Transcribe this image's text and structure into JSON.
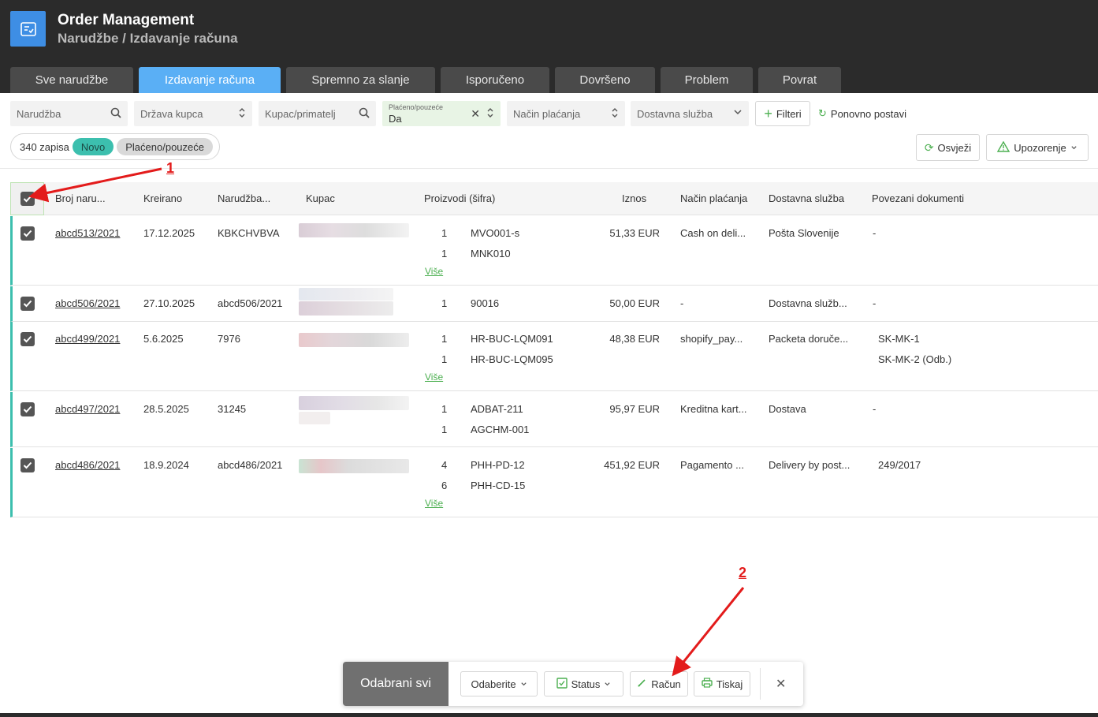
{
  "app": {
    "title": "Order Management",
    "breadcrumb": "Narudžbe / Izdavanje računa"
  },
  "tabs": [
    {
      "label": "Sve narudžbe",
      "active": false
    },
    {
      "label": "Izdavanje računa",
      "active": true
    },
    {
      "label": "Spremno za slanje",
      "active": false
    },
    {
      "label": "Isporučeno",
      "active": false
    },
    {
      "label": "Dovršeno",
      "active": false
    },
    {
      "label": "Problem",
      "active": false
    },
    {
      "label": "Povrat",
      "active": false
    }
  ],
  "filters": {
    "order_placeholder": "Narudžba",
    "country_placeholder": "Država kupca",
    "customer_placeholder": "Kupac/primatelj",
    "paid_label": "Plaćeno/pouzeće",
    "paid_value": "Da",
    "payment_placeholder": "Način plaćanja",
    "delivery_placeholder": "Dostavna služba",
    "filters_button": "Filteri",
    "reset_button": "Ponovno postavi"
  },
  "summary": {
    "count_text": "340 zapisa",
    "tag_new": "Novo",
    "tag_paid": "Plaćeno/pouzeće"
  },
  "actions": {
    "refresh": "Osvježi",
    "warning": "Upozorenje"
  },
  "table": {
    "columns": [
      "Broj naru...",
      "Kreirano",
      "Narudžba...",
      "Kupac",
      "Proizvodi (šifra)",
      "Iznos",
      "Način plaćanja",
      "Dostavna služba",
      "Povezani dokumenti"
    ],
    "more_label": "Više",
    "rows": [
      {
        "number": "abcd513/2021",
        "created": "17.12.2025",
        "order": "KBKCHVBVA",
        "products": [
          {
            "qty": "1",
            "code": "MVO001-s"
          },
          {
            "qty": "1",
            "code": "MNK010"
          }
        ],
        "more": true,
        "amount": "51,33 EUR",
        "payment": "Cash on deli...",
        "delivery": "Pošta Slovenije",
        "docs": [
          "-"
        ]
      },
      {
        "number": "abcd506/2021",
        "created": "27.10.2025",
        "order": "abcd506/2021",
        "products": [
          {
            "qty": "1",
            "code": "90016"
          }
        ],
        "more": false,
        "amount": "50,00 EUR",
        "payment": "-",
        "delivery": "Dostavna služb...",
        "docs": [
          "-"
        ]
      },
      {
        "number": "abcd499/2021",
        "created": "5.6.2025",
        "order": "7976",
        "products": [
          {
            "qty": "1",
            "code": "HR-BUC-LQM091"
          },
          {
            "qty": "1",
            "code": "HR-BUC-LQM095"
          }
        ],
        "more": true,
        "amount": "48,38 EUR",
        "payment": "shopify_pay...",
        "delivery": "Packeta doruče...",
        "docs": [
          "SK-MK-1",
          "SK-MK-2 (Odb.)"
        ]
      },
      {
        "number": "abcd497/2021",
        "created": "28.5.2025",
        "order": "31245",
        "products": [
          {
            "qty": "1",
            "code": "ADBAT-211"
          },
          {
            "qty": "1",
            "code": "AGCHM-001"
          }
        ],
        "more": false,
        "amount": "95,97 EUR",
        "payment": "Kreditna kart...",
        "delivery": "Dostava",
        "docs": [
          "-"
        ]
      },
      {
        "number": "abcd486/2021",
        "created": "18.9.2024",
        "order": "abcd486/2021",
        "products": [
          {
            "qty": "4",
            "code": "PHH-PD-12"
          },
          {
            "qty": "6",
            "code": "PHH-CD-15"
          }
        ],
        "more": true,
        "amount": "451,92 EUR",
        "payment": "Pagamento ...",
        "delivery": "Delivery by post...",
        "docs": [
          "249/2017"
        ]
      }
    ]
  },
  "bulk": {
    "label": "Odabrani svi",
    "select": "Odaberite",
    "status": "Status",
    "invoice": "Račun",
    "print": "Tiskaj"
  },
  "annotations": {
    "one": "1",
    "two": "2"
  },
  "colors": {
    "accent": "#5aaff5",
    "teal": "#3cbfae",
    "annotation": "#e31b1b"
  }
}
